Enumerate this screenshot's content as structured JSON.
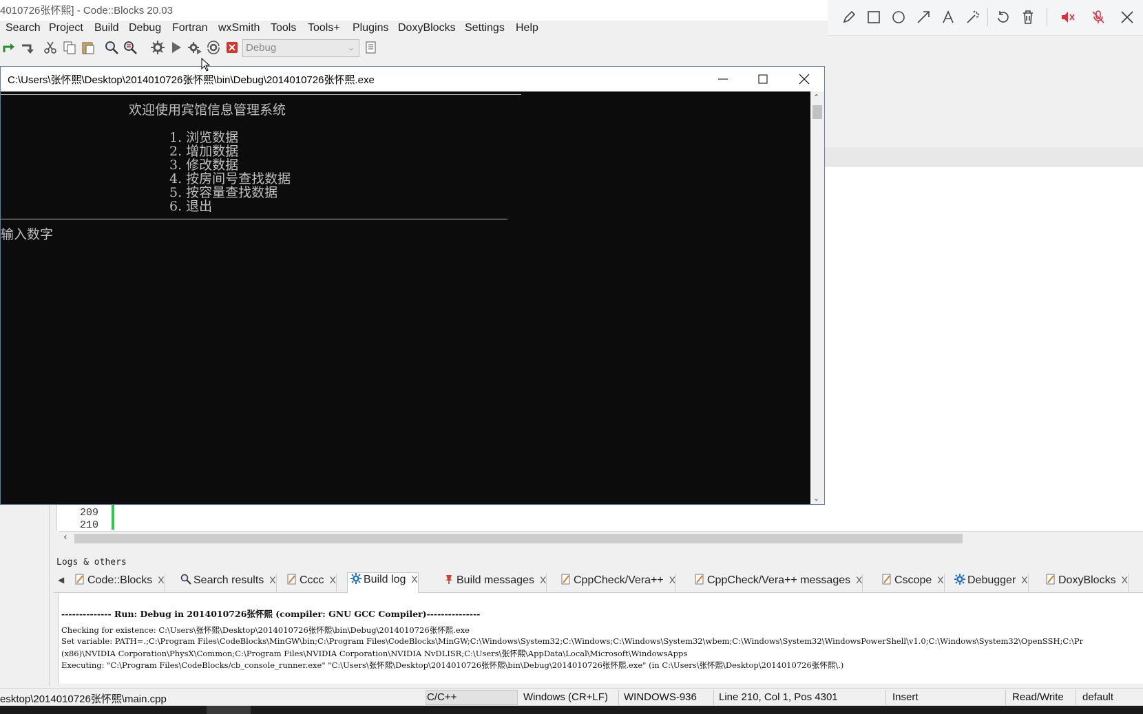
{
  "window": {
    "title": "4010726张怀熙] - Code::Blocks 20.03"
  },
  "menu": [
    "Search",
    "Project",
    "Build",
    "Debug",
    "Fortran",
    "wxSmith",
    "Tools",
    "Tools+",
    "Plugins",
    "DoxyBlocks",
    "Settings",
    "Help"
  ],
  "toolbar": {
    "build_target": "Debug",
    "icons": [
      "redo-icon",
      "undo-icon",
      "cut-icon",
      "copy-icon",
      "paste-icon",
      "find-icon",
      "replace-icon",
      "build-icon",
      "run-icon",
      "build-and-run-icon",
      "rebuild-icon",
      "abort-icon",
      "target-options-icon"
    ]
  },
  "annotation_toolbar": {
    "icons": [
      "pencil-icon",
      "rectangle-icon",
      "circle-icon",
      "arrow-icon",
      "text-icon",
      "magic-wand-icon",
      "undo-icon",
      "trash-icon",
      "speaker-muted-icon",
      "mic-muted-icon",
      "close-icon"
    ]
  },
  "console": {
    "title": "C:\\Users\\张怀熙\\Desktop\\2014010726张怀熙\\bin\\Debug\\2014010726张怀熙.exe",
    "heading": "欢迎使用宾馆信息管理系统",
    "menu_items": [
      "1. 浏览数据",
      "2. 增加数据",
      "3. 修改数据",
      "4. 按房间号查找数据",
      "5. 按容量查找数据",
      "6. 退出"
    ],
    "prompt": "输入数字"
  },
  "editor": {
    "line_numbers": [
      "209",
      "210"
    ]
  },
  "logs": {
    "header": "Logs & others",
    "tabs": [
      {
        "label": "Code::Blocks",
        "icon": "pencil-doc-icon"
      },
      {
        "label": "Search results",
        "icon": "search-icon"
      },
      {
        "label": "Cccc",
        "icon": "pencil-doc-icon"
      },
      {
        "label": "Build log",
        "icon": "gear-icon"
      },
      {
        "label": "Build messages",
        "icon": "pin-icon"
      },
      {
        "label": "CppCheck/Vera++",
        "icon": "pencil-doc-icon"
      },
      {
        "label": "CppCheck/Vera++ messages",
        "icon": "pencil-doc-icon"
      },
      {
        "label": "Cscope",
        "icon": "pencil-doc-icon"
      },
      {
        "label": "Debugger",
        "icon": "gear-icon"
      },
      {
        "label": "DoxyBlocks",
        "icon": "pencil-doc-icon"
      }
    ],
    "active_tab": "Build log",
    "tab_close": "X",
    "lines": [
      "-------------- Run: Debug in 2014010726张怀熙 (compiler: GNU GCC Compiler)---------------",
      "Checking for existence: C:\\Users\\张怀熙\\Desktop\\2014010726张怀熙\\bin\\Debug\\2014010726张怀熙.exe",
      "Set variable: PATH=.;C:\\Program Files\\CodeBlocks\\MinGW\\bin;C:\\Program Files\\CodeBlocks\\MinGW;C:\\Windows\\System32;C:\\Windows;C:\\Windows\\System32\\wbem;C:\\Windows\\System32\\WindowsPowerShell\\v1.0;C:\\Windows\\System32\\OpenSSH;C:\\Pr",
      "(x86)\\NVIDIA Corporation\\PhysX\\Common;C:\\Program Files\\NVIDIA Corporation\\NVIDIA NvDLISR;C:\\Users\\张怀熙\\AppData\\Local\\Microsoft\\WindowsApps",
      "Executing: \"C:\\Program Files\\CodeBlocks/cb_console_runner.exe\" \"C:\\Users\\张怀熙\\Desktop\\2014010726张怀熙\\bin\\Debug\\2014010726张怀熙.exe\"  (in C:\\Users\\张怀熙\\Desktop\\2014010726张怀熙\\.)"
    ]
  },
  "status": {
    "file": "esktop\\2014010726张怀熙\\main.cpp",
    "language": "C/C++",
    "line_endings": "Windows (CR+LF)",
    "encoding": "WINDOWS-936",
    "position": "Line 210, Col 1, Pos 4301",
    "mode": "Insert",
    "access": "Read/Write",
    "profile": "default"
  }
}
